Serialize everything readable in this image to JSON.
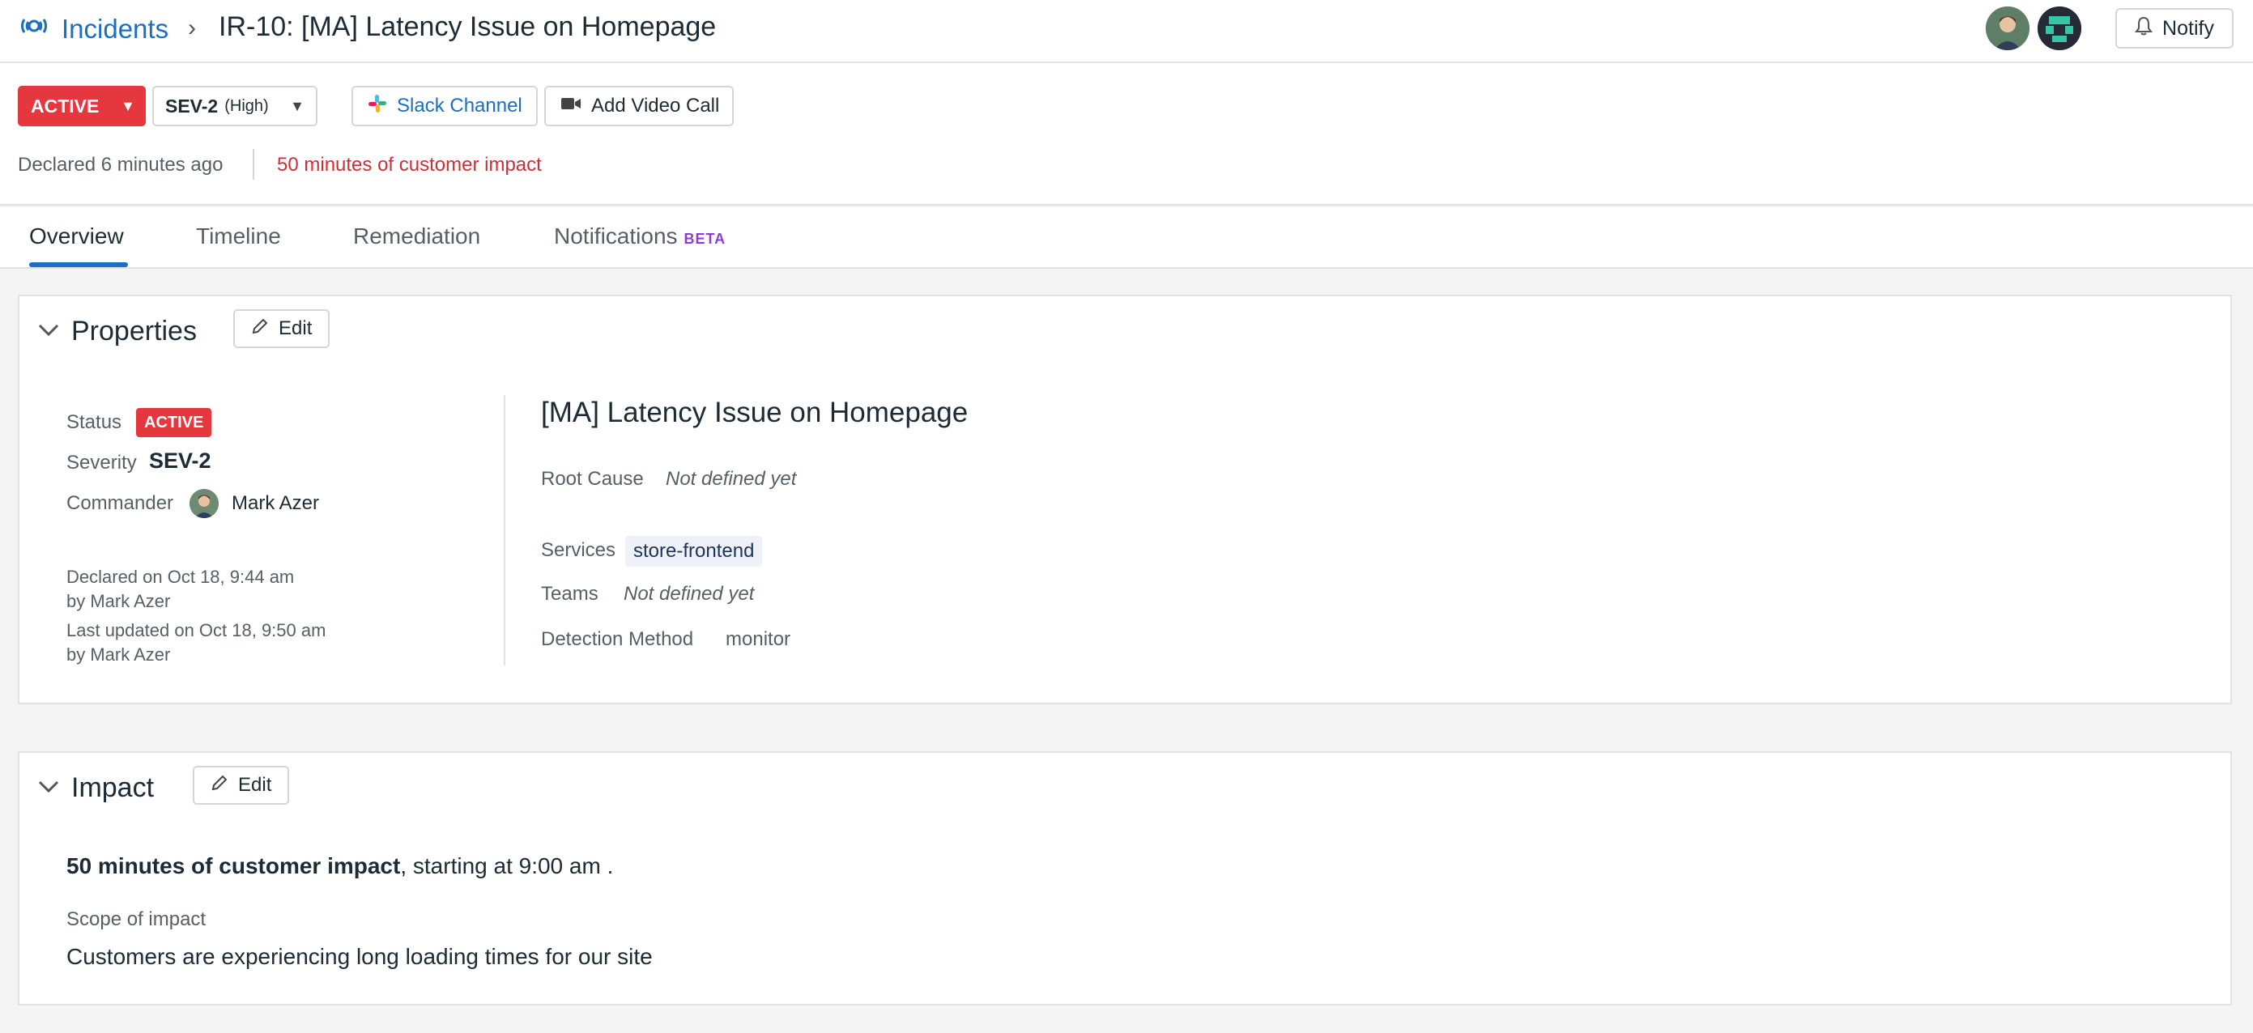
{
  "header": {
    "breadcrumb_root": "Incidents",
    "breadcrumb_sep": "›",
    "title": "IR-10:  [MA] Latency Issue on Homepage",
    "notify_label": "Notify"
  },
  "controls": {
    "status_label": "ACTIVE",
    "severity_label": "SEV-2",
    "severity_priority": "(High)",
    "slack_label": "Slack Channel",
    "video_label": "Add Video Call",
    "declared_ago": "Declared 6 minutes ago",
    "customer_impact": "50 minutes of customer impact"
  },
  "tabs": {
    "overview": "Overview",
    "timeline": "Timeline",
    "remediation": "Remediation",
    "notifications": "Notifications",
    "beta": "BETA"
  },
  "properties": {
    "title": "Properties",
    "edit_label": "Edit",
    "status_label": "Status",
    "status_value": "ACTIVE",
    "severity_label": "Severity",
    "severity_value": "SEV-2",
    "commander_label": "Commander",
    "commander_value": "Mark Azer",
    "declared_on": "Declared on Oct 18, 9:44 am",
    "declared_by": "by Mark Azer",
    "last_updated": "Last updated on Oct 18, 9:50 am",
    "updated_by": "by Mark Azer",
    "incident_title": "[MA] Latency Issue on Homepage",
    "root_cause_label": "Root Cause",
    "root_cause_value": "Not defined yet",
    "services_label": "Services",
    "services_value": "store-frontend",
    "teams_label": "Teams",
    "teams_value": "Not defined yet",
    "detection_label": "Detection Method",
    "detection_value": "monitor"
  },
  "impact": {
    "title": "Impact",
    "edit_label": "Edit",
    "impact_bold": "50 minutes of customer impact",
    "impact_rest": ", starting at 9:00 am .",
    "scope_label": "Scope of impact",
    "scope_value": "Customers are experiencing long loading times for our site"
  },
  "colors": {
    "accent": "#1b6ec2",
    "danger": "#e5373e",
    "beta": "#8b3fd1"
  },
  "icons": [
    "incidents-logo-icon",
    "bell-icon",
    "slack-icon",
    "video-icon",
    "pencil-icon",
    "chevron-down-icon",
    "caret-down-icon"
  ]
}
